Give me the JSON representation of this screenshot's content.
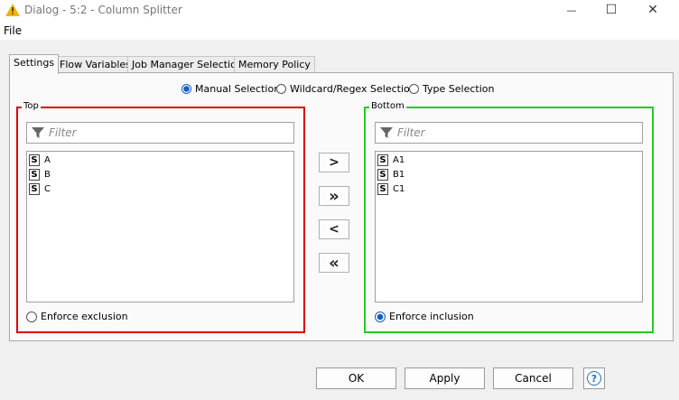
{
  "window": {
    "title": "Dialog - 5:2 - Column Splitter",
    "minimize_symbol": "—",
    "maximize_symbol": "☐",
    "close_symbol": "✕"
  },
  "menu": {
    "file": "File"
  },
  "tabs": [
    {
      "label": "Settings"
    },
    {
      "label": "Flow Variables"
    },
    {
      "label": "Job Manager Selection"
    },
    {
      "label": "Memory Policy"
    }
  ],
  "selection_mode": {
    "options": [
      "Manual Selection",
      "Wildcard/Regex Selection",
      "Type Selection"
    ],
    "selected": "Manual Selection"
  },
  "top": {
    "title": "Top",
    "filter_placeholder": "Filter",
    "type_badge": "S",
    "items": [
      "A",
      "B",
      "C"
    ],
    "enforce_label": "Enforce exclusion",
    "enforce_checked": false,
    "border_color": "#e00000"
  },
  "bottom": {
    "title": "Bottom",
    "filter_placeholder": "Filter",
    "type_badge": "S",
    "items": [
      "A1",
      "B1",
      "C1"
    ],
    "enforce_label": "Enforce inclusion",
    "enforce_checked": true,
    "border_color": "#22cc22"
  },
  "move_buttons": {
    "add": ">",
    "add_all": "»",
    "remove": "<",
    "remove_all": "«"
  },
  "footer": {
    "ok": "OK",
    "apply": "Apply",
    "cancel": "Cancel",
    "help_symbol": "?"
  }
}
